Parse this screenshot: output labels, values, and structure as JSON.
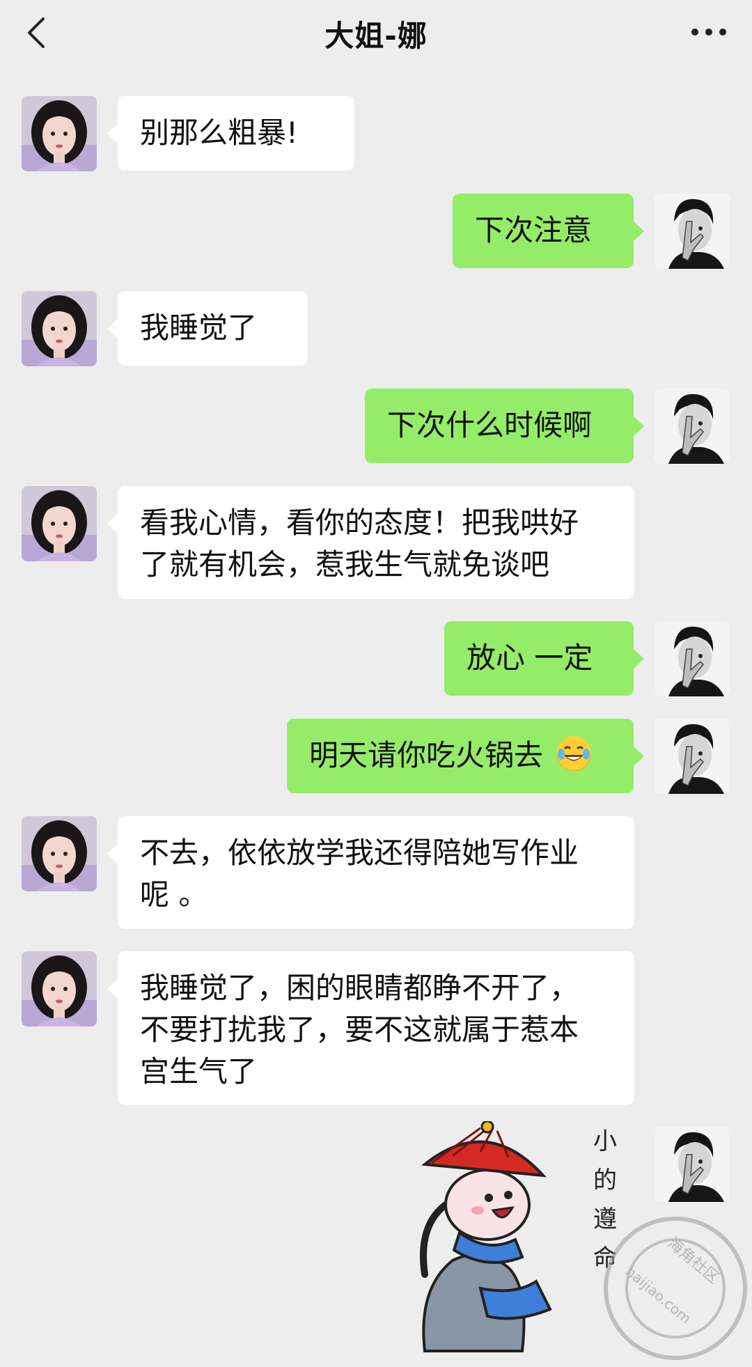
{
  "header": {
    "title": "大姐-娜",
    "back_icon": "chevron-left-icon",
    "more_icon": "more-dots-icon"
  },
  "messages": [
    {
      "from": "them",
      "lines": [
        "别那么粗暴!"
      ]
    },
    {
      "from": "me",
      "lines": [
        "下次注意"
      ]
    },
    {
      "from": "them",
      "lines": [
        "我睡觉了"
      ]
    },
    {
      "from": "me",
      "lines": [
        "下次什么时候啊"
      ]
    },
    {
      "from": "them",
      "lines": [
        "看我心情，看你的态度！把我哄好",
        "了就有机会，惹我生气就免谈吧"
      ]
    },
    {
      "from": "me",
      "lines": [
        "放心 一定"
      ]
    },
    {
      "from": "me",
      "lines": [
        "明天请你吃火锅去"
      ],
      "emoji": "tears-of-joy-emoji"
    },
    {
      "from": "them",
      "lines": [
        "不去，依依放学我还得陪她写作业",
        "呢 。"
      ]
    },
    {
      "from": "them",
      "lines": [
        "我睡觉了，困的眼睛都睁不开了，",
        "不要打扰我了，要不这就属于惹本",
        "宫生气了"
      ]
    }
  ],
  "sticker": {
    "text": [
      "小",
      "的",
      "遵",
      "命"
    ],
    "icon": "qing-servant-bowing-sticker"
  },
  "watermark": {
    "text": "海角社区",
    "subtext": "haijiao.com"
  },
  "colors": {
    "background": "#ededed",
    "incoming_bubble": "#ffffff",
    "outgoing_bubble": "#95ec69"
  }
}
